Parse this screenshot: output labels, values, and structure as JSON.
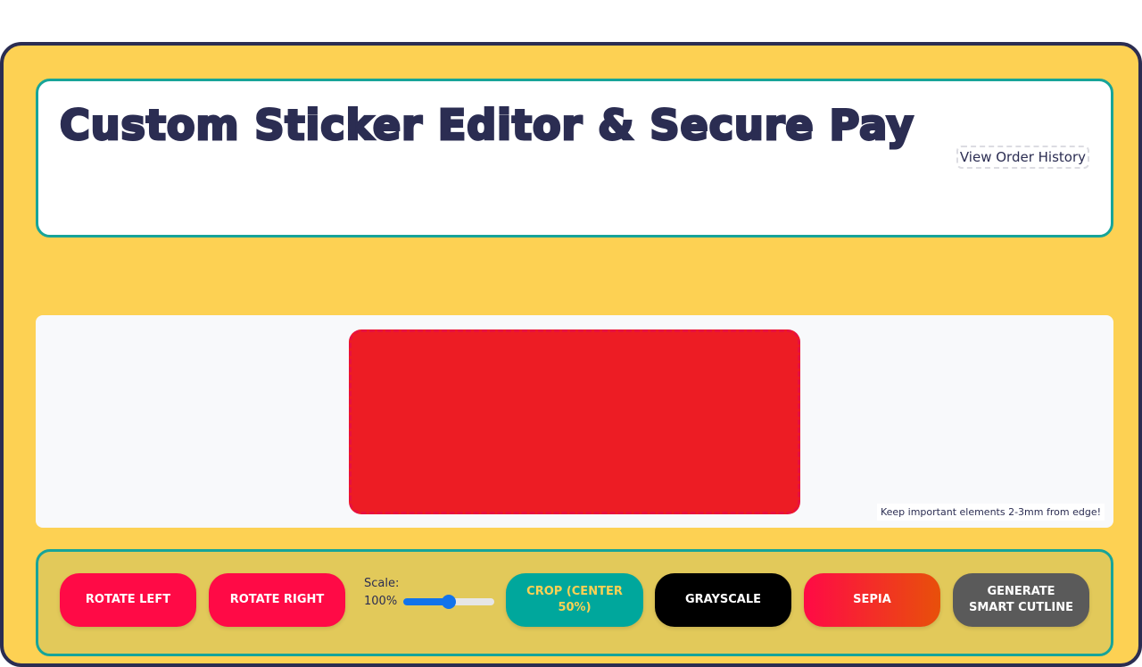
{
  "header": {
    "title": "Custom Sticker Editor & Secure Pay",
    "history_link": "View Order History"
  },
  "canvas": {
    "sticker_color": "#ed1c24",
    "safe_zone_hint": "Keep important elements 2-3mm from edge!"
  },
  "toolbar": {
    "rotate_left": "Rotate Left",
    "rotate_right": "Rotate Right",
    "scale_label": "Scale:",
    "scale_value": "100%",
    "scale_fraction": 0.5,
    "crop": "Crop (Center 50%)",
    "grayscale": "Grayscale",
    "sepia": "Sepia",
    "generate_outline": "Generate Smart Cutline"
  },
  "colors": {
    "frame_background": "#fdd153",
    "frame_border": "#2b2d52",
    "accent_teal": "#17a499",
    "primary_red": "#ff0a46",
    "slider_blue": "#1273ea"
  }
}
